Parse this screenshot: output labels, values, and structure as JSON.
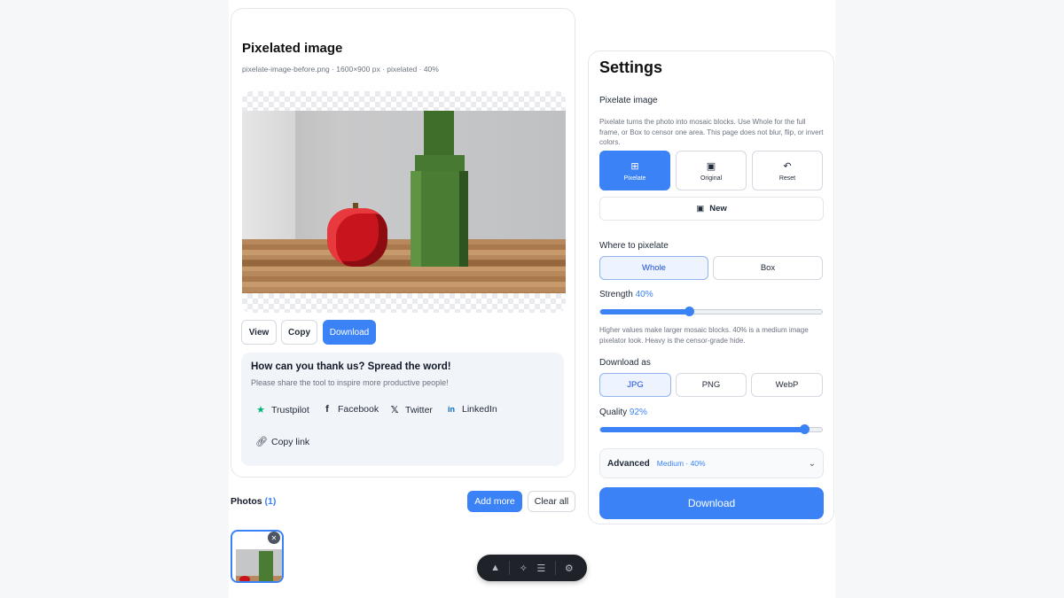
{
  "preview": {
    "title": "Pixelated image",
    "meta": "pixelate-image-before.png · 1600×900 px · pixelated · 40%",
    "actions": {
      "view": "View",
      "copy": "Copy",
      "download": "Download"
    }
  },
  "share": {
    "title": "How can you thank us? Spread the word!",
    "subtitle": "Please share the tool to inspire more productive people!",
    "links": {
      "trustpilot": "Trustpilot",
      "facebook": "Facebook",
      "twitter": "Twitter",
      "linkedin": "LinkedIn",
      "copy_link": "Copy link"
    }
  },
  "photos": {
    "label": "Photos",
    "count": "(1)",
    "add_more": "Add more",
    "clear_all": "Clear all"
  },
  "settings": {
    "title": "Settings",
    "pixelate": {
      "label": "Pixelate image",
      "description": "Pixelate turns the photo into mosaic blocks. Use Whole for the full frame, or Box to censor one area. This page does not blur, flip, or invert colors.",
      "modes": [
        {
          "label": "Pixelate",
          "icon": "grid-icon",
          "active": true
        },
        {
          "label": "Original",
          "icon": "image-icon",
          "active": false
        },
        {
          "label": "Reset",
          "icon": "undo-icon",
          "active": false
        }
      ],
      "new_label": "New"
    },
    "where": {
      "label": "Where to pixelate",
      "options": [
        "Whole",
        "Box"
      ],
      "selected": "Whole"
    },
    "strength": {
      "label": "Strength",
      "value": "40%",
      "level": 0.4,
      "help": "Higher values make larger mosaic blocks. 40% is a medium image pixelator look. Heavy is the censor-grade hide."
    },
    "format": {
      "label": "Download as",
      "options": [
        "JPG",
        "PNG",
        "WebP"
      ],
      "selected": "JPG"
    },
    "quality": {
      "label": "Quality",
      "value": "92%",
      "level": 0.92
    },
    "advanced": {
      "label": "Advanced",
      "value": "Medium · 40%"
    },
    "download": "Download"
  },
  "colors": {
    "accent": "#3b82f6",
    "toolbar": "#1f2329"
  },
  "toolbar": {
    "icons": [
      "logo-icon",
      "sparkle-icon",
      "list-search-icon",
      "gear-icon"
    ]
  }
}
